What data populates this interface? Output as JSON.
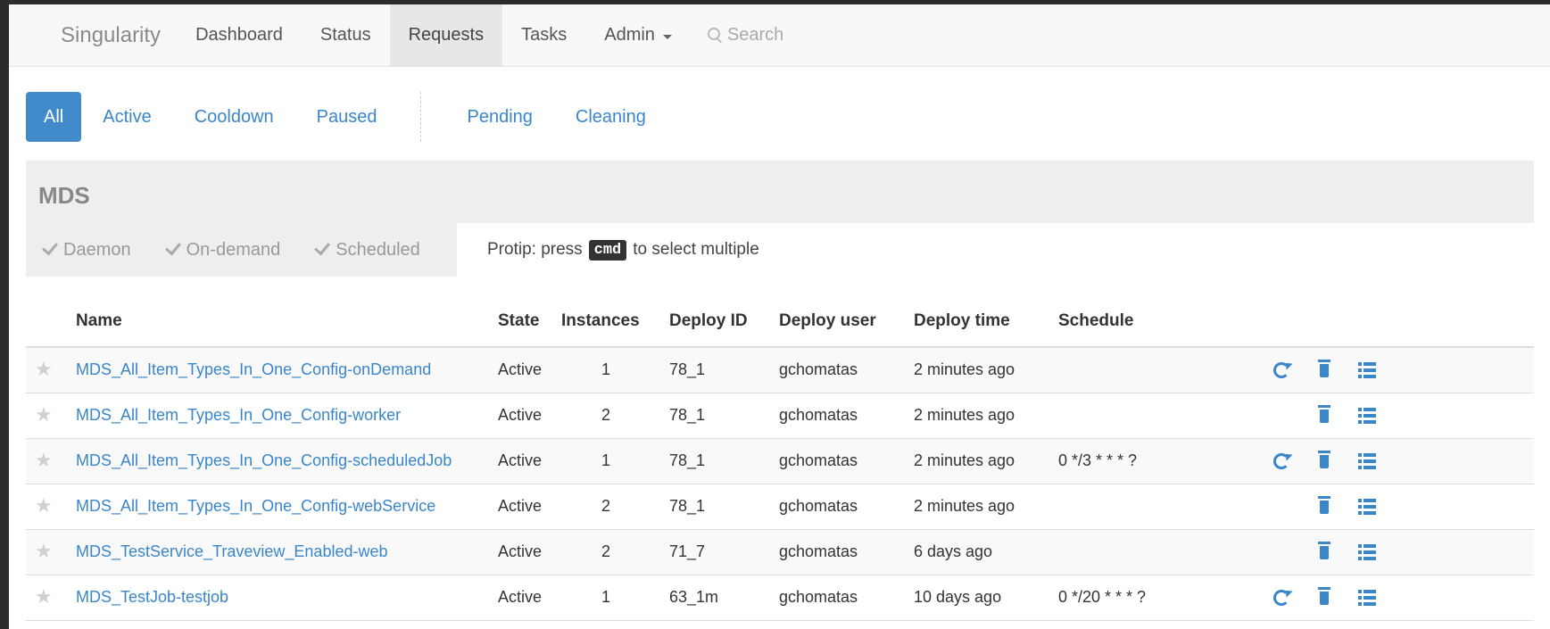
{
  "navbar": {
    "brand": "Singularity",
    "items": [
      {
        "label": "Dashboard",
        "active": false
      },
      {
        "label": "Status",
        "active": false
      },
      {
        "label": "Requests",
        "active": true
      },
      {
        "label": "Tasks",
        "active": false
      }
    ],
    "admin_label": "Admin",
    "search_label": "Search"
  },
  "filters": {
    "state_pills": [
      {
        "label": "All",
        "active": true
      },
      {
        "label": "Active",
        "active": false
      },
      {
        "label": "Cooldown",
        "active": false
      },
      {
        "label": "Paused",
        "active": false
      }
    ],
    "queue_pills": [
      {
        "label": "Pending",
        "active": false
      },
      {
        "label": "Cleaning",
        "active": false
      }
    ]
  },
  "group": {
    "title": "MDS",
    "type_filters": [
      "Daemon",
      "On-demand",
      "Scheduled"
    ],
    "protip_prefix": "Protip: press",
    "protip_key": "cmd",
    "protip_suffix": "to select multiple"
  },
  "table": {
    "columns": [
      "Name",
      "State",
      "Instances",
      "Deploy ID",
      "Deploy user",
      "Deploy time",
      "Schedule"
    ],
    "rows": [
      {
        "name": "MDS_All_Item_Types_In_One_Config-onDemand",
        "state": "Active",
        "instances": "1",
        "deploy_id": "78_1",
        "deploy_user": "gchomatas",
        "deploy_time": "2 minutes ago",
        "schedule": "",
        "can_run": true
      },
      {
        "name": "MDS_All_Item_Types_In_One_Config-worker",
        "state": "Active",
        "instances": "2",
        "deploy_id": "78_1",
        "deploy_user": "gchomatas",
        "deploy_time": "2 minutes ago",
        "schedule": "",
        "can_run": false
      },
      {
        "name": "MDS_All_Item_Types_In_One_Config-scheduledJob",
        "state": "Active",
        "instances": "1",
        "deploy_id": "78_1",
        "deploy_user": "gchomatas",
        "deploy_time": "2 minutes ago",
        "schedule": "0 */3 * * * ?",
        "can_run": true
      },
      {
        "name": "MDS_All_Item_Types_In_One_Config-webService",
        "state": "Active",
        "instances": "2",
        "deploy_id": "78_1",
        "deploy_user": "gchomatas",
        "deploy_time": "2 minutes ago",
        "schedule": "",
        "can_run": false
      },
      {
        "name": "MDS_TestService_Traveview_Enabled-web",
        "state": "Active",
        "instances": "2",
        "deploy_id": "71_7",
        "deploy_user": "gchomatas",
        "deploy_time": "6 days ago",
        "schedule": "",
        "can_run": false
      },
      {
        "name": "MDS_TestJob-testjob",
        "state": "Active",
        "instances": "1",
        "deploy_id": "63_1m",
        "deploy_user": "gchomatas",
        "deploy_time": "10 days ago",
        "schedule": "0 */20 * * * ?",
        "can_run": true
      }
    ]
  },
  "colors": {
    "accent": "#428bca",
    "link": "#3a86c8"
  }
}
